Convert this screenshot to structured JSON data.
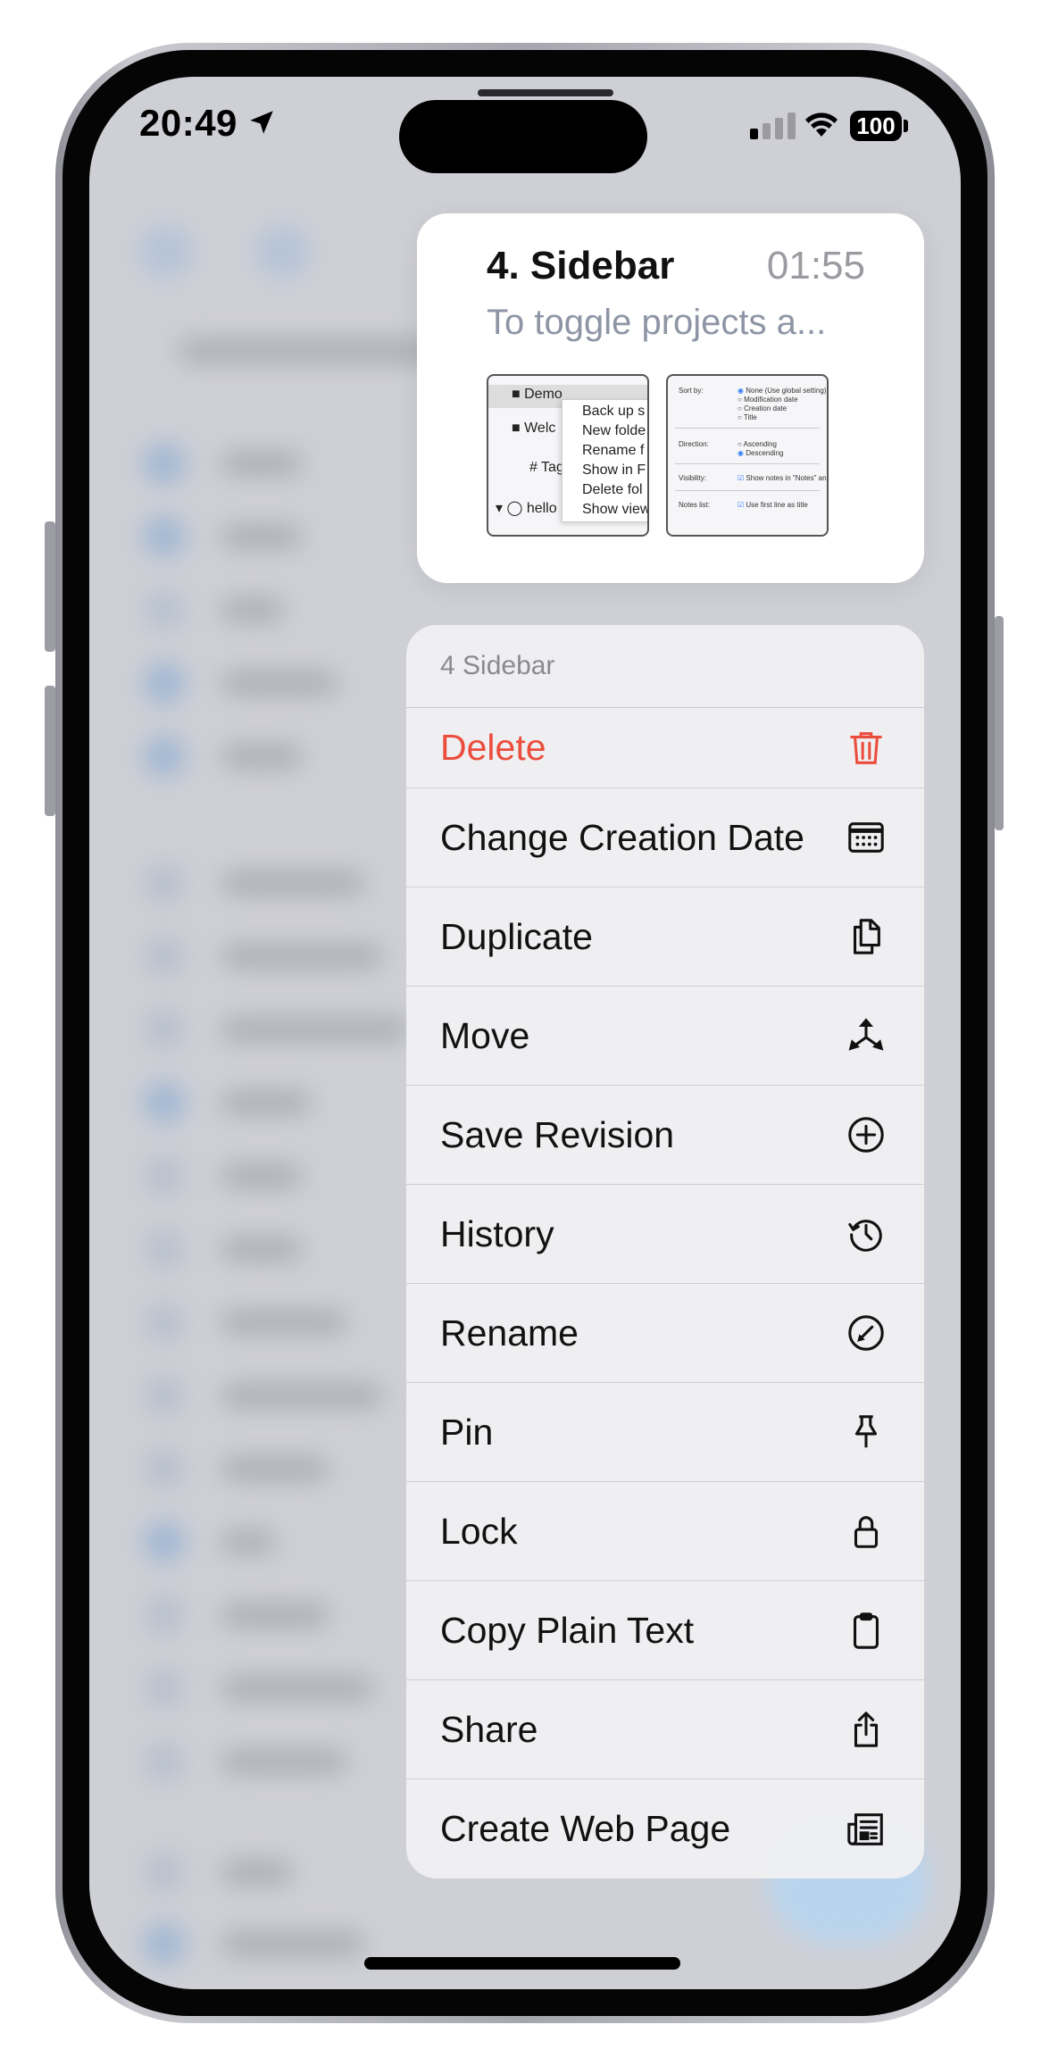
{
  "status_bar": {
    "time": "20:49",
    "battery": "100"
  },
  "preview": {
    "title": "4. Sidebar",
    "time": "01:55",
    "subtitle": "To toggle projects a...",
    "thumb1": [
      "Demo",
      "Welc",
      "# Tag",
      "hello"
    ],
    "thumb1_menu": [
      "Back up s",
      "New folde",
      "Rename f",
      "Show in F",
      "Delete fol",
      "Show view"
    ],
    "thumb2": {
      "sort_label": "Sort by:",
      "sort_options": [
        "None (Use global setting)",
        "Modification date",
        "Creation date",
        "Title"
      ],
      "direction_label": "Direction:",
      "direction_options": [
        "Ascending",
        "Descending"
      ],
      "visibility_label": "Visibility:",
      "visibility_option": "Show notes in \"Notes\" and \"To",
      "notes_list_label": "Notes list:",
      "notes_list_option": "Use first line as title"
    }
  },
  "menu": {
    "header": "4 Sidebar",
    "items": [
      {
        "label": "Delete",
        "icon": "trash-icon",
        "color": "#eb4d3d"
      },
      {
        "label": "Change Creation Date",
        "icon": "calendar-icon"
      },
      {
        "label": "Duplicate",
        "icon": "duplicate-icon"
      },
      {
        "label": "Move",
        "icon": "move-icon"
      },
      {
        "label": "Save Revision",
        "icon": "plus-circle-icon"
      },
      {
        "label": "History",
        "icon": "history-icon"
      },
      {
        "label": "Rename",
        "icon": "pencil-circle-icon"
      },
      {
        "label": "Pin",
        "icon": "pin-icon"
      },
      {
        "label": "Lock",
        "icon": "lock-icon"
      },
      {
        "label": "Copy Plain Text",
        "icon": "clipboard-icon"
      },
      {
        "label": "Share",
        "icon": "share-icon"
      },
      {
        "label": "Create Web Page",
        "icon": "newspaper-icon"
      }
    ]
  }
}
